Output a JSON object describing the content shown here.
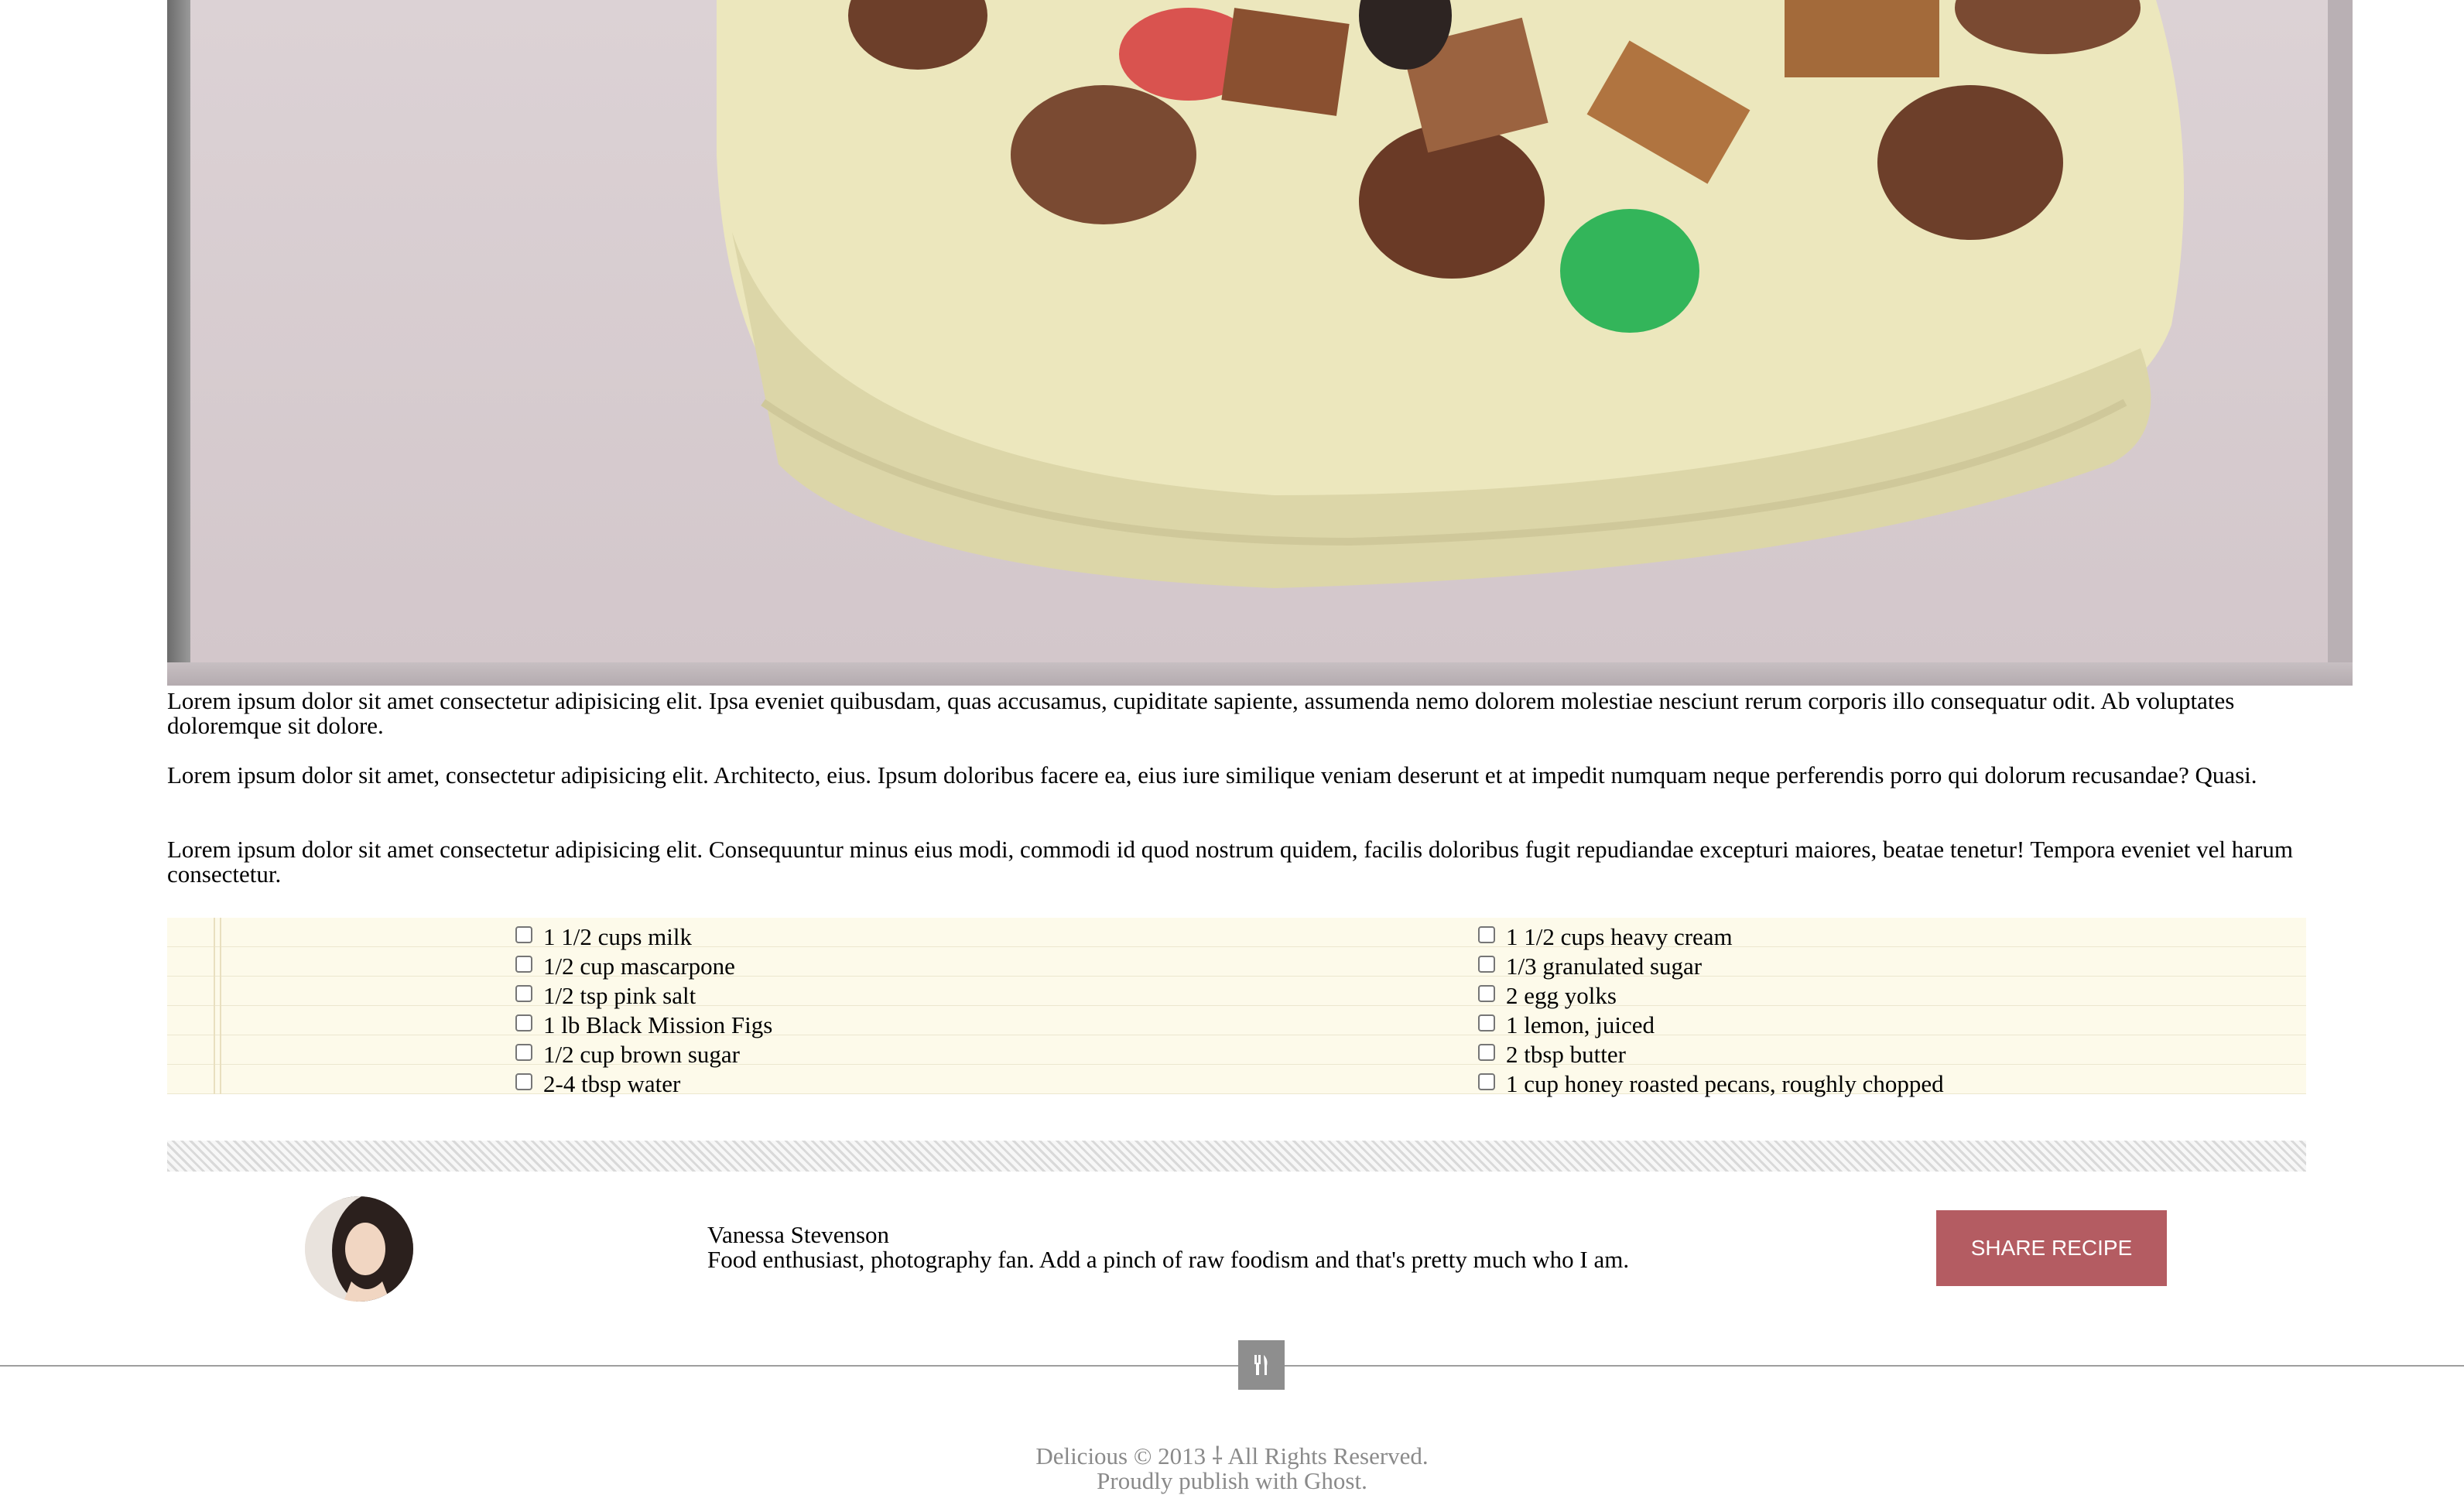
{
  "paragraphs": [
    "Lorem ipsum dolor sit amet consectetur adipisicing elit. Ipsa eveniet quibusdam, quas accusamus, cupiditate sapiente, assumenda nemo dolorem molestiae nesciunt rerum corporis illo consequatur odit. Ab voluptates doloremque sit dolore.",
    "Lorem ipsum dolor sit amet, consectetur adipisicing elit. Architecto, eius. Ipsum doloribus facere ea, eius iure similique veniam deserunt et at impedit numquam neque perferendis porro qui dolorum recusandae? Quasi.",
    "Lorem ipsum dolor sit amet consectetur adipisicing elit. Consequuntur minus eius modi, commodi id quod nostrum quidem, facilis doloribus fugit repudiandae excepturi maiores, beatae tenetur! Tempora eveniet vel harum consectetur."
  ],
  "ingredients": {
    "left": [
      "1 1/2 cups milk",
      "1/2 cup mascarpone",
      "1/2 tsp pink salt",
      "1 lb Black Mission Figs",
      "1/2 cup brown sugar",
      "2-4 tbsp water"
    ],
    "right": [
      "1 1/2 cups heavy cream",
      "1/3 granulated sugar",
      "2 egg yolks",
      "1 lemon, juiced",
      "2 tbsp butter",
      "1 cup honey roasted pecans, roughly chopped"
    ]
  },
  "author": {
    "name": "Vanessa Stevenson",
    "bio": "Food enthusiast, photography fan. Add a pinch of raw foodism and that's pretty much who I am."
  },
  "share_button": "SHARE RECIPE",
  "footer": {
    "copyright": "Delicious © 2013 ⸸ All Rights Reserved.",
    "publish": "Proudly publish with Ghost."
  },
  "colors": {
    "accent": "#b45c62",
    "ingredients_bg": "#fdfaea",
    "footer_text": "#8a8a8a"
  },
  "icons": {
    "footer": "fork-knife-icon"
  }
}
